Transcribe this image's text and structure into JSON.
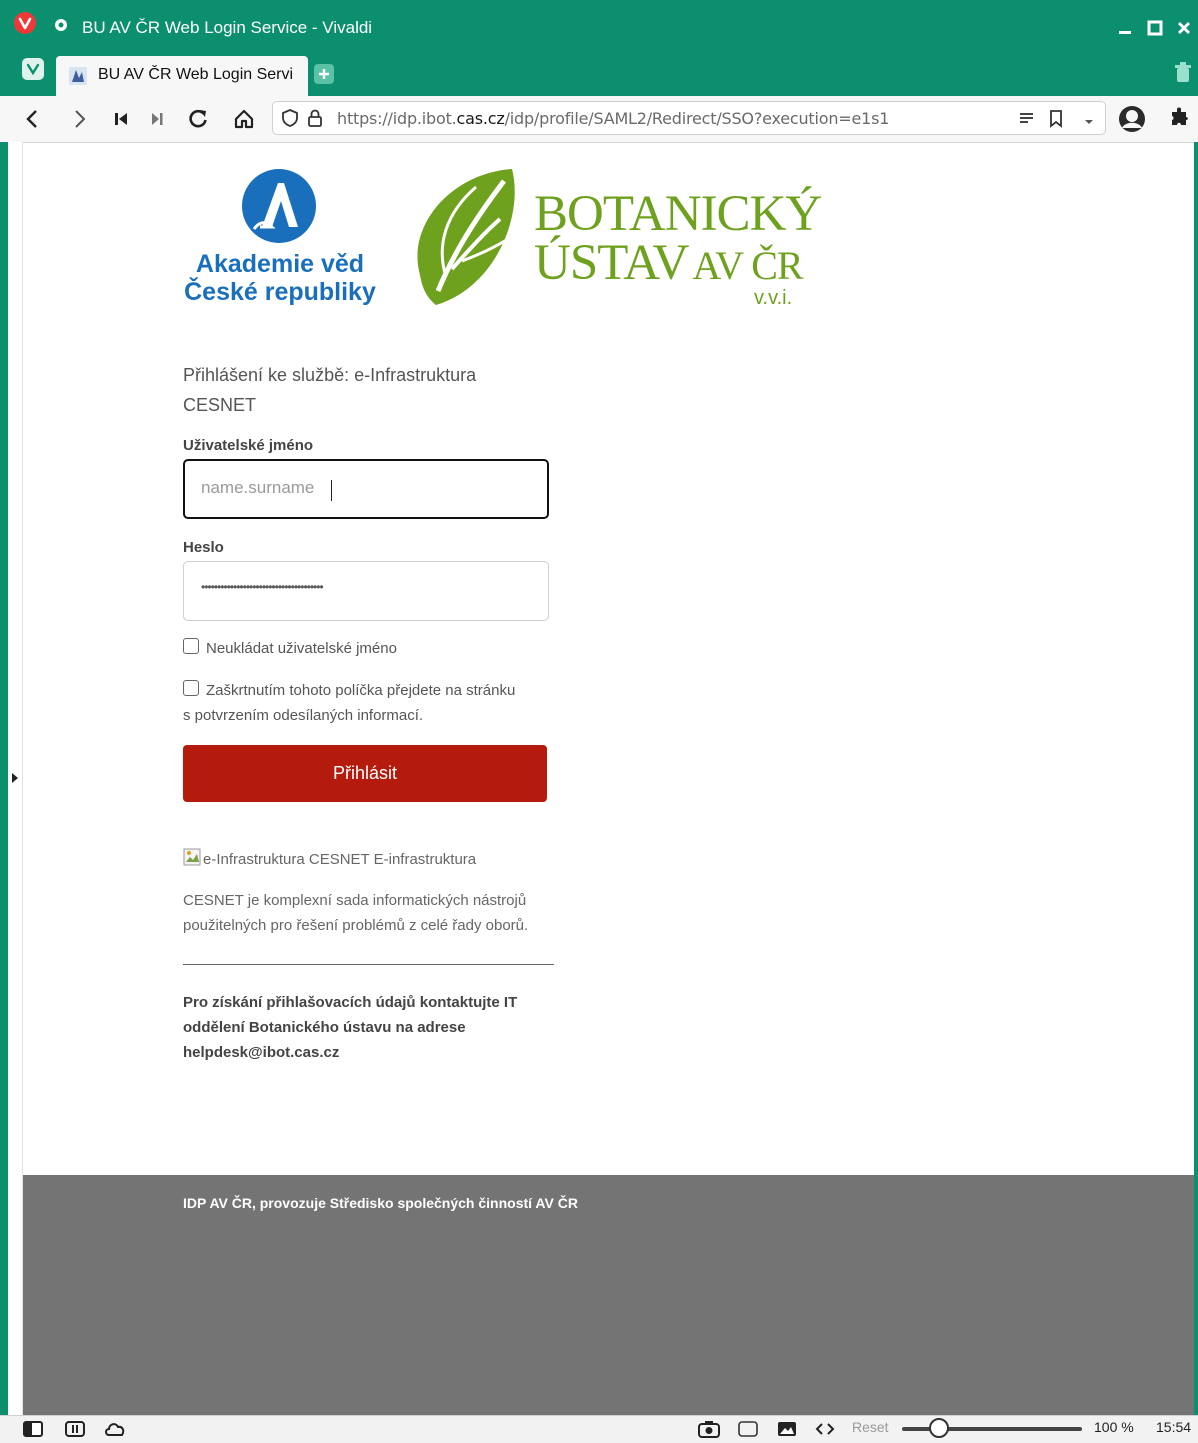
{
  "window": {
    "title": "BU AV ČR Web Login Service - Vivaldi"
  },
  "tab": {
    "title": "BU AV ČR Web Login Servi"
  },
  "address": {
    "prefix": "https://idp.ibot.",
    "domain": "cas.cz",
    "path": "/idp/profile/SAML2/Redirect/SSO?execution=e1s1"
  },
  "logos": {
    "academy_line1": "Akademie věd",
    "academy_line2": "České republiky",
    "botanic_line1": "BOTANICKÝ",
    "botanic_line2": "ÚSTAV",
    "botanic_av": "AV ČR",
    "botanic_vvi": "v.v.i."
  },
  "form": {
    "service_prompt": "Přihlášení ke službě: e-Infrastruktura CESNET",
    "username_label": "Uživatelské jméno",
    "username_value": "name.surname",
    "password_label": "Heslo",
    "password_value": "••••••••••••••••••••••••••••••••••••••",
    "remember_label": "Neukládat uživatelské jméno",
    "consent_label": "Zaškrtnutím tohoto políčka přejdete na stránku s potvrzením odesílaných informací.",
    "login_button": "Přihlásit"
  },
  "info": {
    "broken_image_alt": "e-Infrastruktura CESNET E-infrastruktura",
    "description": "CESNET je komplexní sada informatických nástrojů použitelných pro řešení problémů z celé řady oborů.",
    "contact": "Pro získání přihlašovacích údajů kontaktujte IT oddělení Botanického ústavu na adrese helpdesk@ibot.cas.cz"
  },
  "footer": {
    "text": "IDP AV ČR, provozuje Středisko společných činností AV ČR"
  },
  "statusbar": {
    "reset_label": "Reset",
    "zoom": "100 %",
    "clock": "15:54"
  },
  "colors": {
    "chrome": "#0b8f6e",
    "login_button": "#b51b0c",
    "academy_blue": "#1a6fbd",
    "botanic_green": "#6ea11e",
    "footer": "#747474"
  }
}
